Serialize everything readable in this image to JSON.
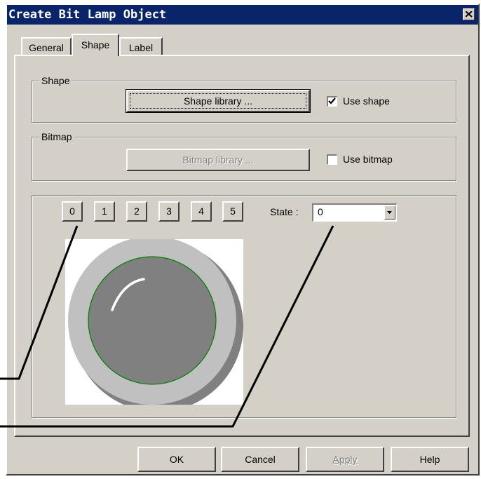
{
  "window": {
    "title": "Create Bit Lamp Object"
  },
  "tabs": [
    {
      "label": "General"
    },
    {
      "label": "Shape"
    },
    {
      "label": "Label"
    }
  ],
  "shape_group": {
    "label": "Shape",
    "button_label": "Shape  library ...",
    "checkbox_label": "Use shape",
    "checked": true
  },
  "bitmap_group": {
    "label": "Bitmap",
    "button_label": "Bitmap  library ...",
    "checkbox_label": "Use bitmap",
    "checked": false
  },
  "states": {
    "buttons": [
      "0",
      "1",
      "2",
      "3",
      "4",
      "5"
    ],
    "label": "State :",
    "value": "0"
  },
  "footer": {
    "ok": "OK",
    "cancel": "Cancel",
    "apply": "Apply",
    "help": "Help"
  },
  "colors": {
    "title_bar": "#0a246a",
    "dialog_face": "#d4d0c8",
    "lamp_ring": "#c0c0c0",
    "lamp_fill": "#808080",
    "lamp_outline": "#008000"
  }
}
